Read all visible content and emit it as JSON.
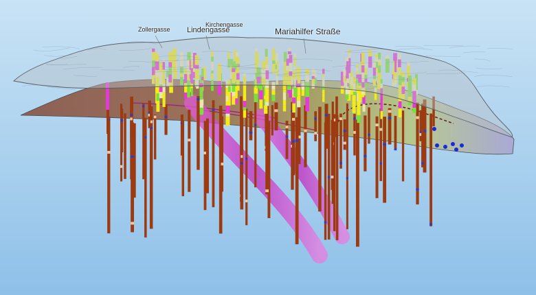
{
  "labels": {
    "zollergasse": "Zollergasse",
    "lindengasse": "Lindengasse",
    "kirchengasse": "Kirchengasse",
    "mariahilfer": "Mariahilfer Straße"
  }
}
